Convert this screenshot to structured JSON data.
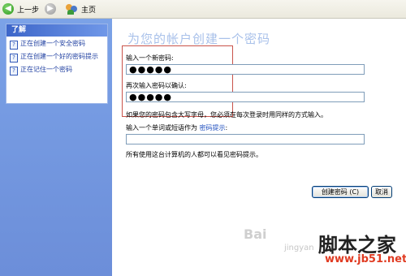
{
  "toolbar": {
    "back_label": "上一步",
    "home_label": "主页"
  },
  "sidebar": {
    "heading": "了解",
    "items": [
      {
        "label": "正在创建一个安全密码"
      },
      {
        "label": "正在创建一个好的密码提示"
      },
      {
        "label": "正在记住一个密码"
      }
    ]
  },
  "main": {
    "title": "为您的帐户创建一个密码",
    "new_password_label": "输入一个新密码:",
    "new_password_value": "●●●●●",
    "confirm_label": "再次输入密码以确认:",
    "confirm_value": "●●●●●",
    "case_note": "如果您的密码包含大写字母，您必须在每次登录时用同样的方式输入。",
    "hint_label_prefix": "输入一个单词或短语作为",
    "hint_link": "密码提示",
    "hint_label_suffix": ":",
    "hint_value": "",
    "visibility_note": "所有使用这台计算机的人都可以看见密码提示。",
    "create_button": "创建密码 (C)",
    "cancel_button": "取消"
  },
  "watermark": {
    "site_name": "脚本之家",
    "site_url": "www.jb51.net",
    "baidu": "Bai",
    "jingyan": "jingyan"
  },
  "colors": {
    "sidebar_bg": "#7ba2e7",
    "panel_header": "#3d66c9",
    "title_text": "#a9c1ea",
    "link": "#1f4fbf",
    "highlight_box": "#c9534a",
    "watermark_url": "#e03b22"
  }
}
